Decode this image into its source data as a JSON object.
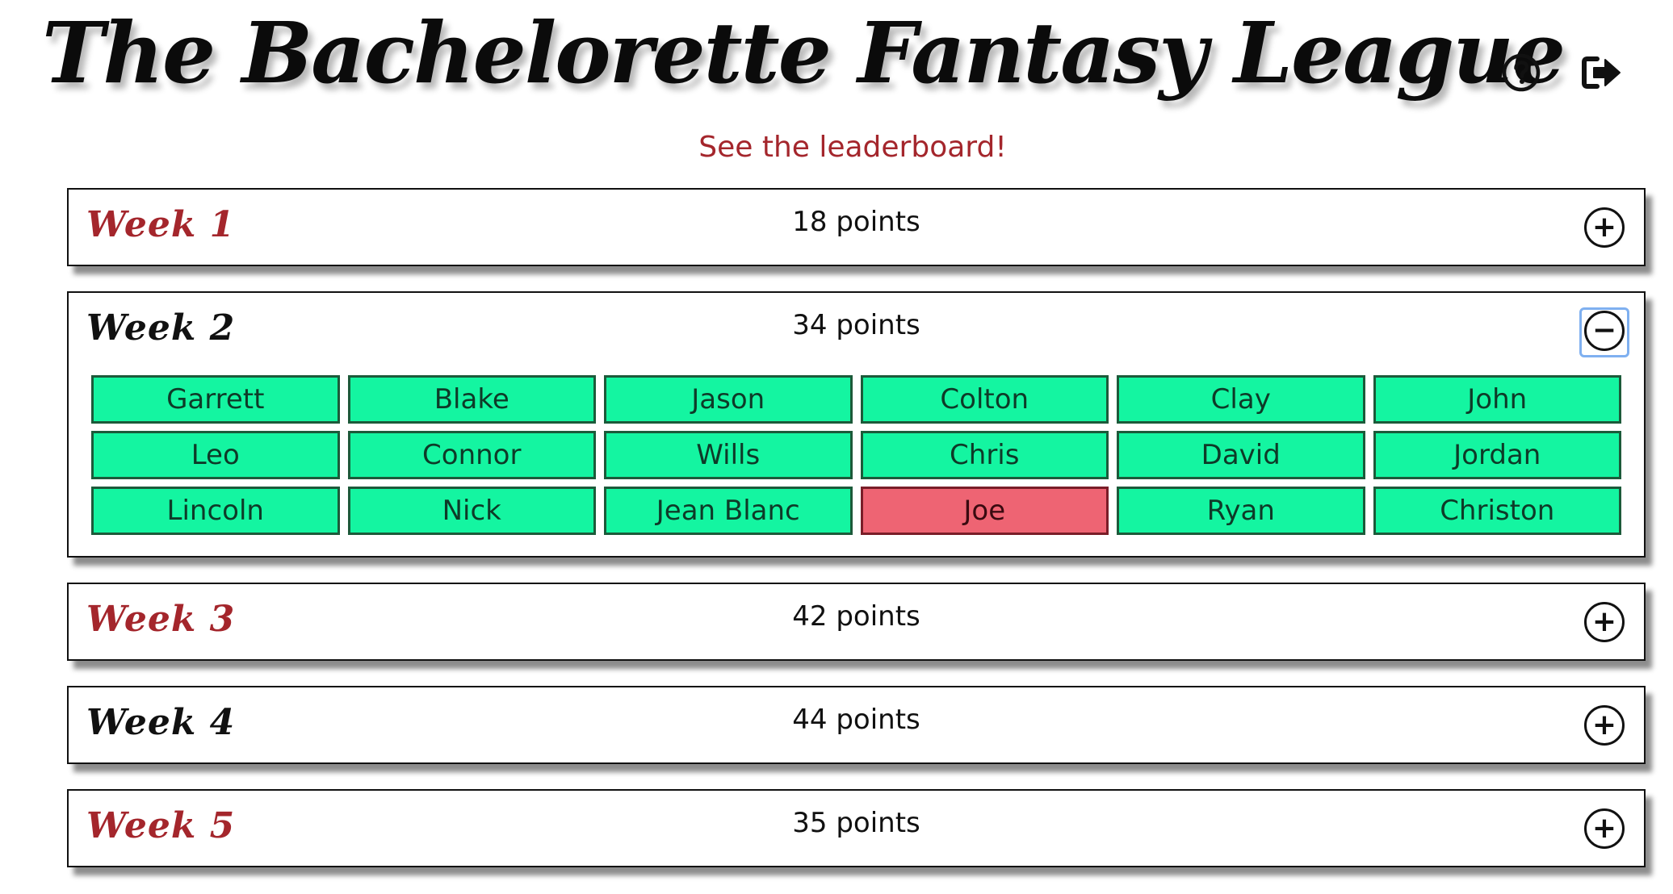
{
  "header": {
    "title": "The Bachelorette Fantasy League",
    "help_icon": "question-circle-icon",
    "logout_icon": "sign-out-icon"
  },
  "leaderboard_link": "See the leaderboard!",
  "colors": {
    "accent_red": "#a4262c",
    "active_green": "#14f5a1",
    "eliminated_red": "#ee6473",
    "focus_blue": "#7fb0f0"
  },
  "weeks": [
    {
      "title": "Week 1",
      "points": "18 points",
      "toggle": "+",
      "expanded": false
    },
    {
      "title": "Week 2",
      "points": "34 points",
      "toggle": "−",
      "expanded": true,
      "contestants": [
        {
          "name": "Garrett",
          "status": "active"
        },
        {
          "name": "Blake",
          "status": "active"
        },
        {
          "name": "Jason",
          "status": "active"
        },
        {
          "name": "Colton",
          "status": "active"
        },
        {
          "name": "Clay",
          "status": "active"
        },
        {
          "name": "John",
          "status": "active"
        },
        {
          "name": "Leo",
          "status": "active"
        },
        {
          "name": "Connor",
          "status": "active"
        },
        {
          "name": "Wills",
          "status": "active"
        },
        {
          "name": "Chris",
          "status": "active"
        },
        {
          "name": "David",
          "status": "active"
        },
        {
          "name": "Jordan",
          "status": "active"
        },
        {
          "name": "Lincoln",
          "status": "active"
        },
        {
          "name": "Nick",
          "status": "active"
        },
        {
          "name": "Jean Blanc",
          "status": "active"
        },
        {
          "name": "Joe",
          "status": "eliminated"
        },
        {
          "name": "Ryan",
          "status": "active"
        },
        {
          "name": "Christon",
          "status": "active"
        }
      ]
    },
    {
      "title": "Week 3",
      "points": "42 points",
      "toggle": "+",
      "expanded": false
    },
    {
      "title": "Week 4",
      "points": "44 points",
      "toggle": "+",
      "expanded": false
    },
    {
      "title": "Week 5",
      "points": "35 points",
      "toggle": "+",
      "expanded": false
    }
  ]
}
